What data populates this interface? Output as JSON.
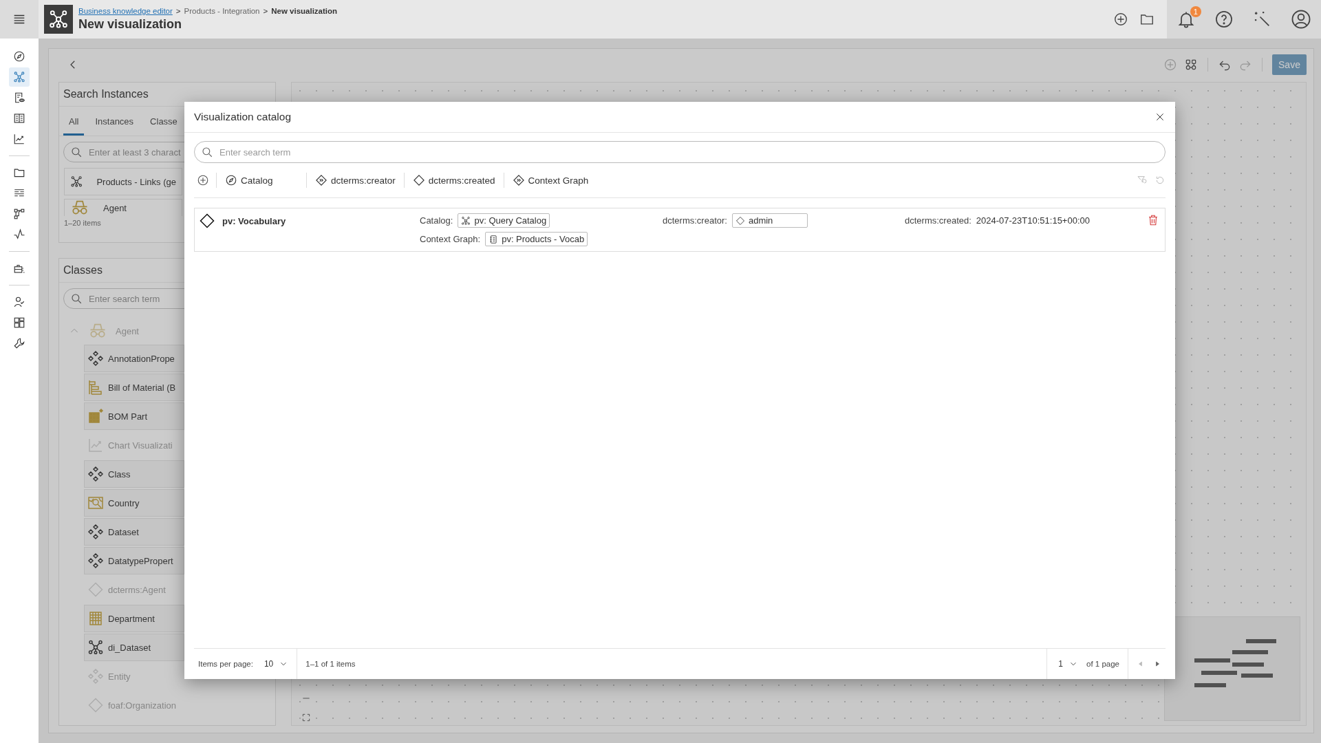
{
  "app_bar": {
    "breadcrumb": [
      {
        "kind": "link",
        "label": "Business knowledge editor"
      },
      {
        "kind": "separator",
        "label": ">"
      },
      {
        "kind": "plain",
        "label": "Products - Integration"
      },
      {
        "kind": "separator",
        "label": ">"
      },
      {
        "kind": "current",
        "label": "New visualization"
      }
    ],
    "title": "New visualization",
    "notification_badge": "1"
  },
  "rail": {
    "groups": [
      [
        {
          "selected": false
        },
        {
          "selected": true
        },
        {
          "selected": false
        },
        {
          "selected": false
        },
        {
          "selected": false
        }
      ],
      [
        {
          "selected": false
        },
        {
          "selected": false
        },
        {
          "selected": false
        },
        {
          "selected": false
        }
      ],
      [
        {
          "selected": false
        }
      ],
      [
        {
          "selected": false
        },
        {
          "selected": false
        },
        {
          "selected": false
        }
      ]
    ]
  },
  "toolbar": {
    "save": "Save"
  },
  "search_instances": {
    "title": "Search Instances",
    "tabs": [
      {
        "label": "All",
        "selected": true
      },
      {
        "label": "Instances",
        "selected": false
      },
      {
        "label": "Classe",
        "selected": false
      }
    ],
    "search": {
      "placeholder": "Enter at least 3 charact"
    },
    "results": [
      {
        "label": "Products - Links (ge",
        "kind": "graph"
      },
      {
        "label": "Agent",
        "kind": "agent"
      }
    ],
    "count": "1–20 items"
  },
  "classes": {
    "title": "Classes",
    "search": {
      "placeholder": "Enter search term"
    },
    "tree": [
      {
        "label": "Agent",
        "kind": "agent",
        "expanded": true,
        "disabled": true,
        "children": [
          {
            "label": "AnnotationPrope",
            "kind": "class",
            "disabled": false
          },
          {
            "label": "Bill of Material (B",
            "kind": "bom",
            "disabled": false
          },
          {
            "label": "BOM Part",
            "kind": "part",
            "disabled": false
          },
          {
            "label": "Chart Visualizati",
            "kind": "chart",
            "disabled": true
          },
          {
            "label": "Class",
            "kind": "class",
            "disabled": false
          },
          {
            "label": "Country",
            "kind": "country",
            "disabled": false
          },
          {
            "label": "Dataset",
            "kind": "class",
            "disabled": false
          },
          {
            "label": "DatatypePropert",
            "kind": "class",
            "disabled": false
          },
          {
            "label": "dcterms:Agent",
            "kind": "diamond",
            "disabled": true
          },
          {
            "label": "Department",
            "kind": "department",
            "disabled": false
          },
          {
            "label": "di_Dataset",
            "kind": "graph",
            "disabled": false
          },
          {
            "label": "Entity",
            "kind": "class",
            "disabled": true
          },
          {
            "label": "foaf:Organization",
            "kind": "diamond",
            "disabled": true
          }
        ]
      }
    ]
  },
  "modal": {
    "title": "Visualization catalog",
    "search": {
      "placeholder": "Enter search term"
    },
    "columns": [
      {
        "label": "Catalog",
        "kind": "compass"
      },
      {
        "label": "dcterms:creator",
        "kind": "object"
      },
      {
        "label": "dcterms:created",
        "kind": "literal"
      },
      {
        "label": "Context Graph",
        "kind": "object"
      }
    ],
    "rows": [
      {
        "title": "pv: Vocabulary",
        "fields": [
          {
            "label": "Catalog:",
            "value": "pv: Query Catalog",
            "kind": "graph"
          },
          {
            "label": "dcterms:creator:",
            "value": "admin",
            "kind": "resource"
          },
          {
            "label": "dcterms:created:",
            "value": "2024-07-23T10:51:15+00:00",
            "kind": "literal"
          },
          {
            "label": "Context Graph:",
            "value": "pv: Products - Vocab",
            "kind": "document"
          }
        ]
      }
    ],
    "footer": {
      "items_per_page_label": "Items per page:",
      "page_size": "10",
      "range": "1–1 of 1 items",
      "page": "1",
      "page_of": "of 1 page"
    }
  }
}
